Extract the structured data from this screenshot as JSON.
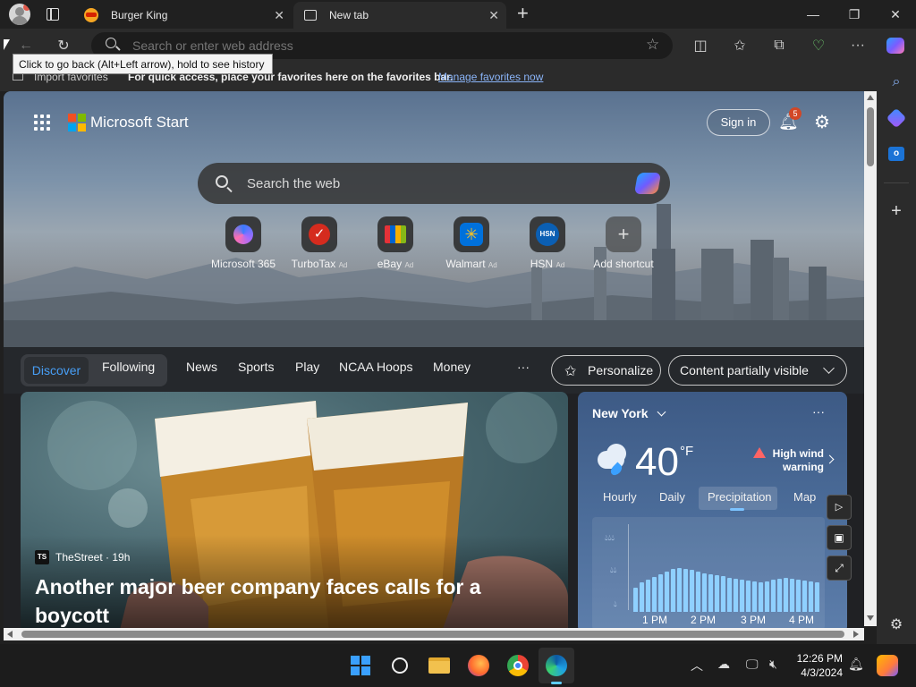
{
  "tabs": [
    {
      "label": "Burger King",
      "icon": "burger-king-icon"
    },
    {
      "label": "New tab",
      "icon": "new-tab-icon"
    }
  ],
  "address": {
    "placeholder": "Search or enter web address"
  },
  "tooltip": "Click to go back (Alt+Left arrow), hold to see history",
  "favbar": {
    "import": "Import favorites",
    "message": "For quick access, place your favorites here on the favorites bar.",
    "link": "Manage favorites now"
  },
  "header": {
    "brand": "Microsoft Start",
    "sign_in": "Sign in",
    "notification_count": "5"
  },
  "search": {
    "placeholder": "Search the web"
  },
  "shortcuts": [
    {
      "label": "Microsoft 365",
      "ad": ""
    },
    {
      "label": "TurboTax",
      "ad": "Ad"
    },
    {
      "label": "eBay",
      "ad": "Ad"
    },
    {
      "label": "Walmart",
      "ad": "Ad"
    },
    {
      "label": "HSN",
      "ad": "Ad",
      "badge": "HSN"
    },
    {
      "label": "Add shortcut",
      "ad": ""
    }
  ],
  "feed_tabs": {
    "discover": "Discover",
    "following": "Following",
    "items": [
      "News",
      "Sports",
      "Play",
      "NCAA Hoops",
      "Money"
    ],
    "more": "···",
    "personalize": "Personalize",
    "content_visibility": "Content partially visible"
  },
  "article": {
    "source_logo": "TS",
    "source": "TheStreet · 19h",
    "headline": "Another major beer company faces calls for a boycott"
  },
  "weather": {
    "location": "New York",
    "temperature": "40",
    "unit": "°F",
    "alert": "High wind warning",
    "tabs": [
      "Hourly",
      "Daily",
      "Precipitation",
      "Map"
    ],
    "active_tab": "Precipitation",
    "time_labels": [
      "1 PM",
      "2 PM",
      "3 PM",
      "4 PM"
    ],
    "precip_levels": [
      0.45,
      0.55,
      0.6,
      0.65,
      0.7,
      0.75,
      0.8,
      0.82,
      0.8,
      0.78,
      0.75,
      0.72,
      0.7,
      0.68,
      0.66,
      0.64,
      0.62,
      0.6,
      0.58,
      0.56,
      0.55,
      0.56,
      0.6,
      0.62,
      0.64,
      0.62,
      0.6,
      0.58,
      0.56,
      0.55
    ]
  },
  "clock": {
    "time": "12:26 PM",
    "date": "4/3/2024"
  },
  "colors": {
    "accent": "#479ef5",
    "link": "#8ab4f8",
    "notification": "#d24726",
    "precip_bar": "#8fd0ff"
  }
}
